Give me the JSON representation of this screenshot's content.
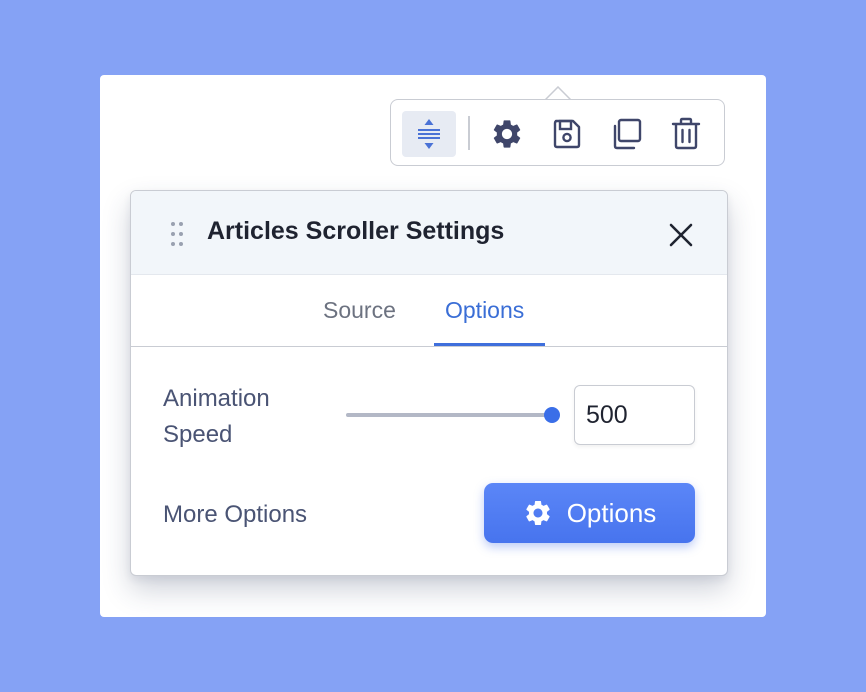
{
  "toolbar": {
    "buttons": [
      {
        "icon": "align-vertical-icon",
        "active": true
      },
      {
        "icon": "gear-icon"
      },
      {
        "icon": "save-icon"
      },
      {
        "icon": "duplicate-icon"
      },
      {
        "icon": "trash-icon"
      }
    ]
  },
  "panel": {
    "title": "Articles Scroller Settings",
    "close_icon": "close-icon",
    "drag_icon": "drag-handle-icon"
  },
  "tabs": [
    {
      "label": "Source",
      "active": false
    },
    {
      "label": "Options",
      "active": true
    }
  ],
  "animation_speed": {
    "label_line1": "Animation",
    "label_line2": "Speed",
    "value": "500",
    "slider_fraction": 1.0
  },
  "more_options": {
    "label": "More Options",
    "button_label": "Options",
    "button_icon": "gear-icon"
  },
  "colors": {
    "background": "#85a2f5",
    "accent": "#3a6ee8",
    "active_tab": "#3a6ed6",
    "icon": "#3f466a"
  }
}
